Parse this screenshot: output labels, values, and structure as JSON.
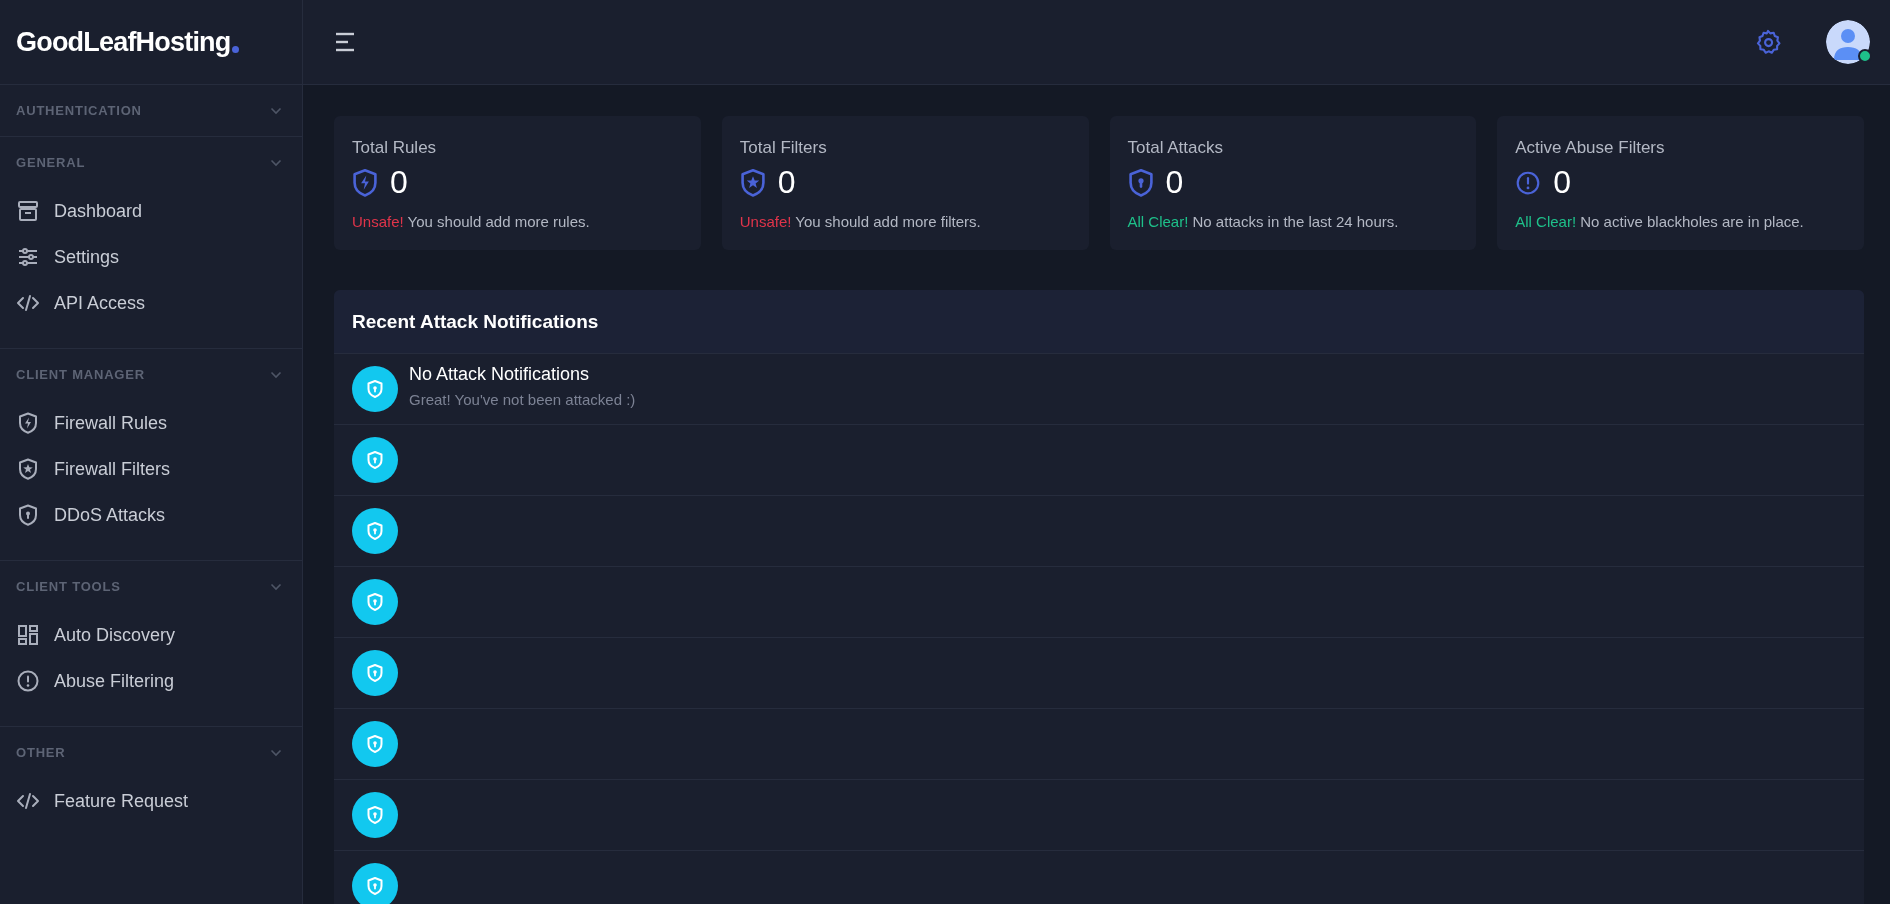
{
  "brand": {
    "name": "GoodLeafHosting"
  },
  "sidebar": {
    "sections": [
      {
        "header": "AUTHENTICATION"
      },
      {
        "header": "GENERAL",
        "items": [
          {
            "label": "Dashboard"
          },
          {
            "label": "Settings"
          },
          {
            "label": "API Access"
          }
        ]
      },
      {
        "header": "CLIENT MANAGER",
        "items": [
          {
            "label": "Firewall Rules"
          },
          {
            "label": "Firewall Filters"
          },
          {
            "label": "DDoS Attacks"
          }
        ]
      },
      {
        "header": "CLIENT TOOLS",
        "items": [
          {
            "label": "Auto Discovery"
          },
          {
            "label": "Abuse Filtering"
          }
        ]
      },
      {
        "header": "OTHER",
        "items": [
          {
            "label": "Feature Request"
          }
        ]
      }
    ]
  },
  "topbar": {
    "user": {
      "online": true
    }
  },
  "stats": [
    {
      "title": "Total Rules",
      "value": "0",
      "status": "Unsafe!",
      "kind": "unsafe",
      "message": "You should add more rules."
    },
    {
      "title": "Total Filters",
      "value": "0",
      "status": "Unsafe!",
      "kind": "unsafe",
      "message": "You should add more filters."
    },
    {
      "title": "Total Attacks",
      "value": "0",
      "status": "All Clear!",
      "kind": "clear",
      "message": "No attacks in the last 24 hours."
    },
    {
      "title": "Active Abuse Filters",
      "value": "0",
      "status": "All Clear!",
      "kind": "clear",
      "message": "No active blackholes are in place."
    }
  ],
  "notifications": {
    "title": "Recent Attack Notifications",
    "items": [
      {
        "kind": "message",
        "title": "No Attack Notifications",
        "text": "Great! You've not been attacked :)"
      },
      {
        "kind": "empty"
      },
      {
        "kind": "empty"
      },
      {
        "kind": "empty"
      },
      {
        "kind": "empty"
      },
      {
        "kind": "empty"
      },
      {
        "kind": "empty"
      },
      {
        "kind": "empty"
      }
    ]
  }
}
